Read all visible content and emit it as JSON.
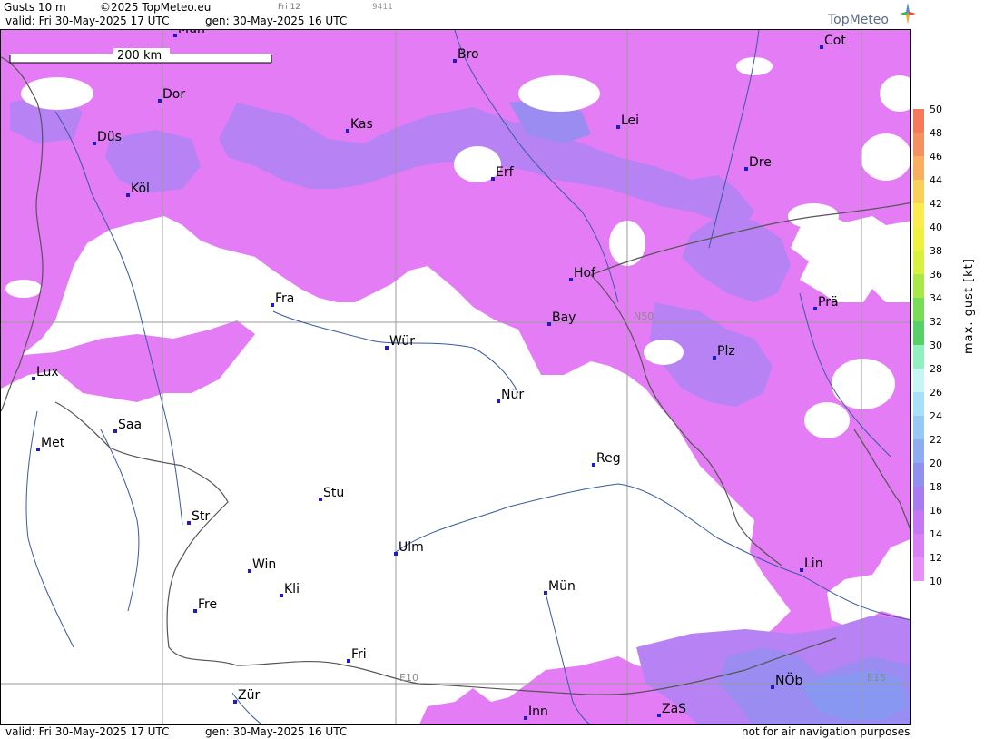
{
  "header": {
    "title": "Gusts 10 m",
    "copyright": "©2025 TopMeteo.eu",
    "run_tag": "Fri 12",
    "code": "9411",
    "valid": "valid:  Fri  30-May-2025  17 UTC",
    "generated": "gen:  30-May-2025 16 UTC",
    "logo": "TopMeteo"
  },
  "footer": {
    "valid": "valid:  Fri  30-May-2025  17 UTC",
    "generated": "gen:  30-May-2025 16 UTC",
    "disclaimer": "not for air navigation purposes"
  },
  "map": {
    "scale_label": "200 km",
    "grid_labels": {
      "lat": "N50",
      "lon1": "E10",
      "lon2": "E15"
    },
    "cities": [
      {
        "name": "Mün"
      },
      {
        "name": "Bro"
      },
      {
        "name": "Cot"
      },
      {
        "name": "Dor"
      },
      {
        "name": "Kas"
      },
      {
        "name": "Lei"
      },
      {
        "name": "Düs"
      },
      {
        "name": "Erf"
      },
      {
        "name": "Dre"
      },
      {
        "name": "Köl"
      },
      {
        "name": "Hof"
      },
      {
        "name": "Fra"
      },
      {
        "name": "Prä"
      },
      {
        "name": "Bay"
      },
      {
        "name": "Wür"
      },
      {
        "name": "Plz"
      },
      {
        "name": "Lux"
      },
      {
        "name": "Nür"
      },
      {
        "name": "Saa"
      },
      {
        "name": "Met"
      },
      {
        "name": "Reg"
      },
      {
        "name": "Stu"
      },
      {
        "name": "Str"
      },
      {
        "name": "Ulm"
      },
      {
        "name": "Lin"
      },
      {
        "name": "Win"
      },
      {
        "name": "Kli"
      },
      {
        "name": "Mün"
      },
      {
        "name": "Fre"
      },
      {
        "name": "Fri"
      },
      {
        "name": "NÖb"
      },
      {
        "name": "Zür"
      },
      {
        "name": "Inn"
      },
      {
        "name": "ZaS"
      }
    ]
  },
  "legend": {
    "label": "max. gust [kt]",
    "ticks": [
      "50",
      "48",
      "46",
      "44",
      "42",
      "40",
      "38",
      "36",
      "34",
      "32",
      "30",
      "28",
      "26",
      "24",
      "22",
      "20",
      "18",
      "16",
      "14",
      "12",
      "10"
    ],
    "colors": [
      "#f47a5a",
      "#f59060",
      "#f8b060",
      "#fbd05a",
      "#fcec50",
      "#f0f040",
      "#d8f040",
      "#a8e848",
      "#78dc58",
      "#58d068",
      "#90f0c0",
      "#c8f4f4",
      "#a8e0f8",
      "#98c8f4",
      "#90acf0",
      "#9090f0",
      "#a87cf0",
      "#c478f4",
      "#d880f4",
      "#e890f8"
    ],
    "map_colors": {
      "weak": "#e47cf6",
      "medium": "#b682f4",
      "strong": "#9a8cf0",
      "peak": "#8898f2"
    }
  }
}
